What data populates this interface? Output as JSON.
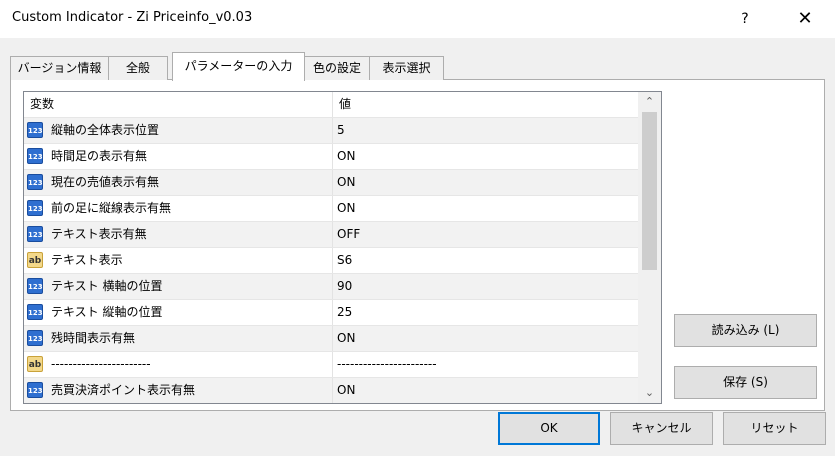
{
  "window": {
    "title": "Custom Indicator - Zi Priceinfo_v0.03",
    "help_glyph": "?",
    "close_glyph": "✕"
  },
  "tabs": [
    {
      "label": "バージョン情報",
      "active": false
    },
    {
      "label": "全般",
      "active": false
    },
    {
      "label": "パラメーターの入力",
      "active": true
    },
    {
      "label": "色の設定",
      "active": false
    },
    {
      "label": "表示選択",
      "active": false
    }
  ],
  "grid": {
    "header_name": "変数",
    "header_value": "値",
    "rows": [
      {
        "type": "num",
        "icon_text": "123",
        "name": "縦軸の全体表示位置",
        "value": "5"
      },
      {
        "type": "num",
        "icon_text": "123",
        "name": "時間足の表示有無",
        "value": "ON"
      },
      {
        "type": "num",
        "icon_text": "123",
        "name": "現在の売値表示有無",
        "value": "ON"
      },
      {
        "type": "num",
        "icon_text": "123",
        "name": "前の足に縦線表示有無",
        "value": "ON"
      },
      {
        "type": "num",
        "icon_text": "123",
        "name": "テキスト表示有無",
        "value": "OFF"
      },
      {
        "type": "str",
        "icon_text": "ab",
        "name": "テキスト表示",
        "value": "S6"
      },
      {
        "type": "num",
        "icon_text": "123",
        "name": "テキスト 横軸の位置",
        "value": "90"
      },
      {
        "type": "num",
        "icon_text": "123",
        "name": "テキスト 縦軸の位置",
        "value": "25"
      },
      {
        "type": "num",
        "icon_text": "123",
        "name": "残時間表示有無",
        "value": "ON"
      },
      {
        "type": "str",
        "icon_text": "ab",
        "name": "-----------------------",
        "value": "-----------------------"
      },
      {
        "type": "num",
        "icon_text": "123",
        "name": "売買決済ポイント表示有無",
        "value": "ON"
      }
    ],
    "scroll_up_glyph": "⌃",
    "scroll_down_glyph": "⌄"
  },
  "buttons": {
    "load": "読み込み (L)",
    "save": "保存 (S)",
    "ok": "OK",
    "cancel": "キャンセル",
    "reset": "リセット"
  }
}
